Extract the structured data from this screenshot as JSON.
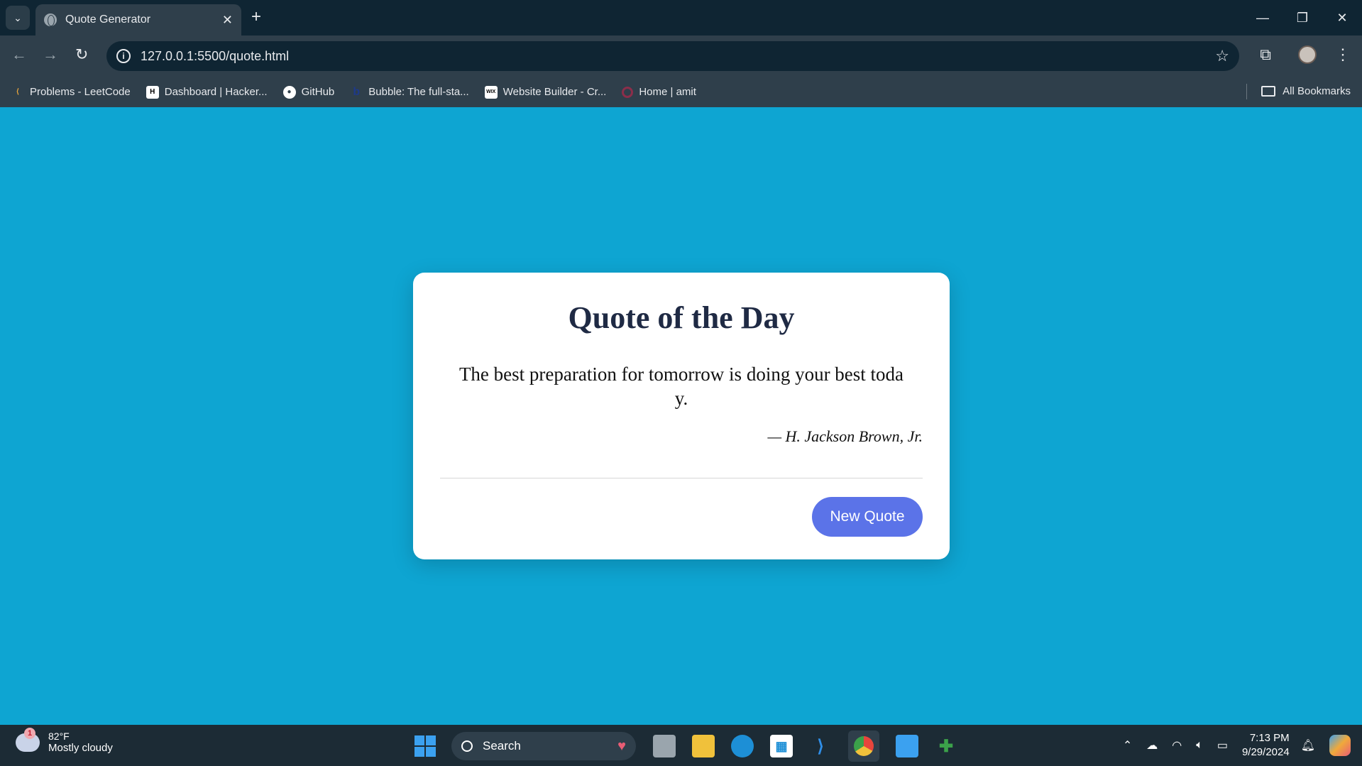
{
  "browser": {
    "tab_title": "Quote Generator",
    "url": "127.0.0.1:5500/quote.html",
    "bookmarks": [
      {
        "label": "Problems - LeetCode",
        "icon": "leetcode-icon"
      },
      {
        "label": "Dashboard | Hacker...",
        "icon": "hackerrank-icon"
      },
      {
        "label": "GitHub",
        "icon": "github-icon"
      },
      {
        "label": "Bubble: The full-sta...",
        "icon": "bubble-icon"
      },
      {
        "label": "Website Builder - Cr...",
        "icon": "wix-icon"
      },
      {
        "label": "Home | amit",
        "icon": "ring-icon"
      }
    ],
    "all_bookmarks": "All Bookmarks"
  },
  "card": {
    "title": "Quote of the Day",
    "quote": "The best preparation for tomorrow is doing your best today.",
    "author": "— H. Jackson Brown, Jr.",
    "button": "New Quote"
  },
  "taskbar": {
    "temp": "82°F",
    "weather": "Mostly cloudy",
    "weather_badge": "1",
    "search": "Search",
    "time": "7:13 PM",
    "date": "9/29/2024"
  },
  "colors": {
    "page_bg": "#0ea5d2",
    "button": "#5b73e8",
    "title": "#1f2a44"
  }
}
